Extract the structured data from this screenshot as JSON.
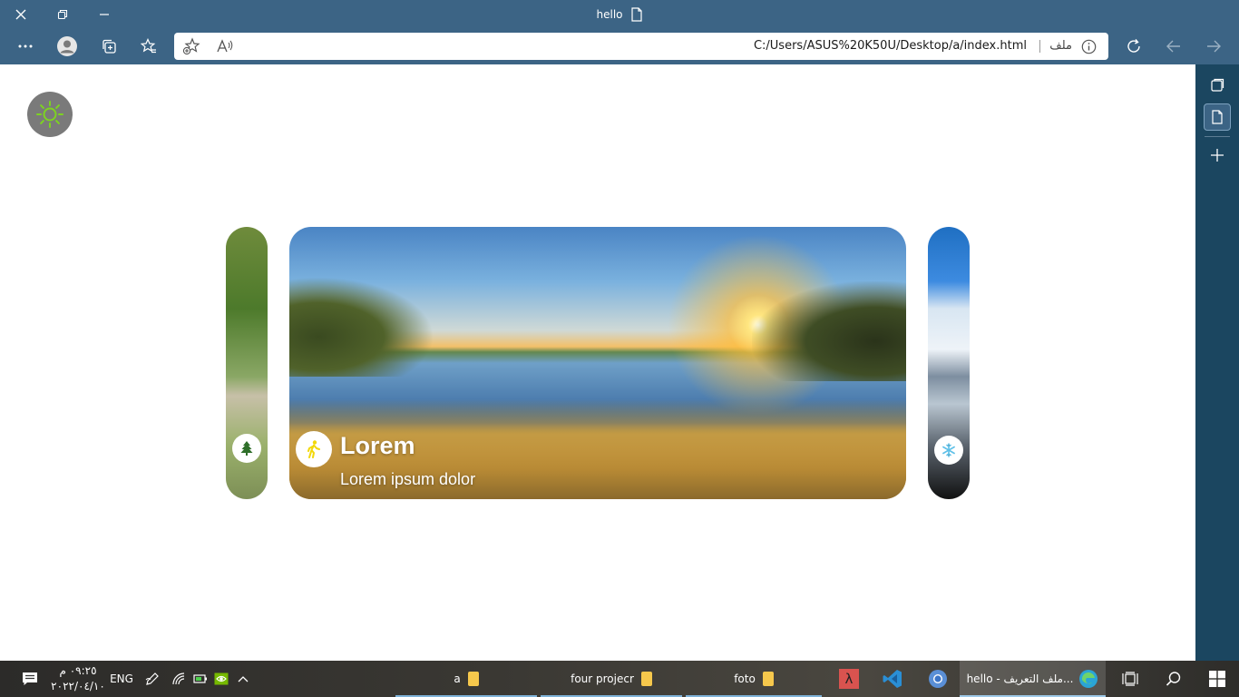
{
  "browser": {
    "window_title": "hello",
    "url": "C:/Users/ASUS%20K50U/Desktop/a/index.html",
    "site_info_label": "ملف"
  },
  "page": {
    "cards": {
      "main": {
        "title": "Lorem",
        "subtitle": "Lorem ipsum dolor"
      }
    }
  },
  "taskbar": {
    "language": "ENG",
    "clock_time": "٠٩:٢٥ م",
    "clock_date": "٢٠٢٢/٠٤/١٠",
    "apps": [
      {
        "label": "a"
      },
      {
        "label": "four projecr"
      },
      {
        "label": "foto"
      },
      {
        "label": "hello - ملف التعريف..."
      }
    ]
  },
  "colors": {
    "browser_chrome": "#3c6485",
    "sidebar": "#1b4660",
    "toggle_bg": "#7a7a7a",
    "sun_icon": "#7dd321"
  },
  "icons": [
    "close-icon",
    "restore-icon",
    "minimize-icon",
    "page-icon",
    "more-icon",
    "profile-icon",
    "collections-icon",
    "favorites-icon",
    "add-favorite-icon",
    "read-aloud-icon",
    "info-icon",
    "refresh-icon",
    "back-icon",
    "forward-icon",
    "sun-icon",
    "tree-icon",
    "walking-icon",
    "snowflake-icon",
    "plus-icon",
    "search-icon",
    "windows-icon"
  ]
}
